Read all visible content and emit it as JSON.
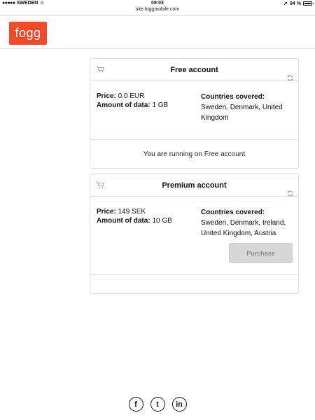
{
  "statusbar": {
    "carrier": "SWEDEN",
    "signal_dots": "●●●●●",
    "wifi": "≈",
    "time": "09:03",
    "location": "➚",
    "battery": "94 %"
  },
  "browser": {
    "url": "site.foggmobile.com"
  },
  "header": {
    "logo_text": "fogg",
    "logo_color": "#f04a2b"
  },
  "plans": [
    {
      "title": "Free account",
      "price_label": "Price:",
      "price_value": "0.0 EUR",
      "data_label": "Amount of data:",
      "data_value": "1 GB",
      "countries_label": "Countries covered:",
      "countries_value": "Sweden, Denmark, United Kingdom",
      "footer_text": "You are running on Free account"
    },
    {
      "title": "Premium account",
      "price_label": "Price:",
      "price_value": "149 SEK",
      "data_label": "Amount of data:",
      "data_value": "10 GB",
      "countries_label": "Countries covered:",
      "countries_value": "Sweden, Denmark, Ireland, United Kingdom, Austria",
      "button_label": "Purchase"
    }
  ],
  "social": {
    "facebook": "f",
    "twitter": "t",
    "linkedin": "in"
  }
}
